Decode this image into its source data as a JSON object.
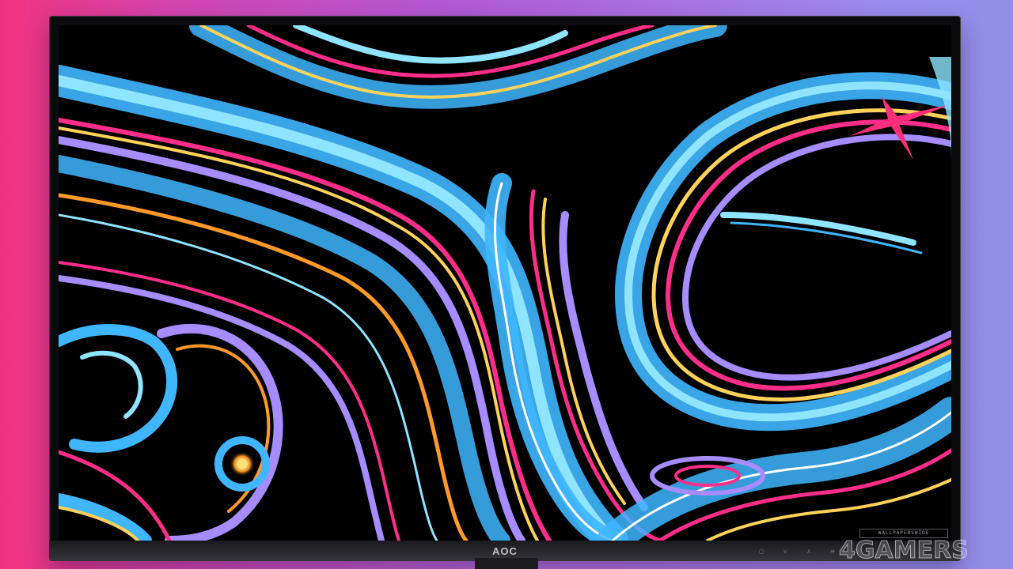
{
  "monitor": {
    "brand_label": "AOC",
    "button_glyphs": [
      "○",
      "∨",
      "∧",
      "≡",
      "⏻"
    ],
    "wallpaper_credit": "WALLPAPERSWIDE"
  },
  "watermark": {
    "text": "4GAMERS"
  },
  "colors": {
    "background_left": "#f0337e",
    "background_right": "#8f8fe6",
    "bezel": "#0b0b0d",
    "wave_blue": "#3fb6ff",
    "wave_cyan": "#8fe4ff",
    "wave_pink": "#ff2d8a",
    "wave_yellow": "#ffd25a",
    "wave_violet": "#a68cff",
    "wave_orange": "#ff9a2a"
  }
}
